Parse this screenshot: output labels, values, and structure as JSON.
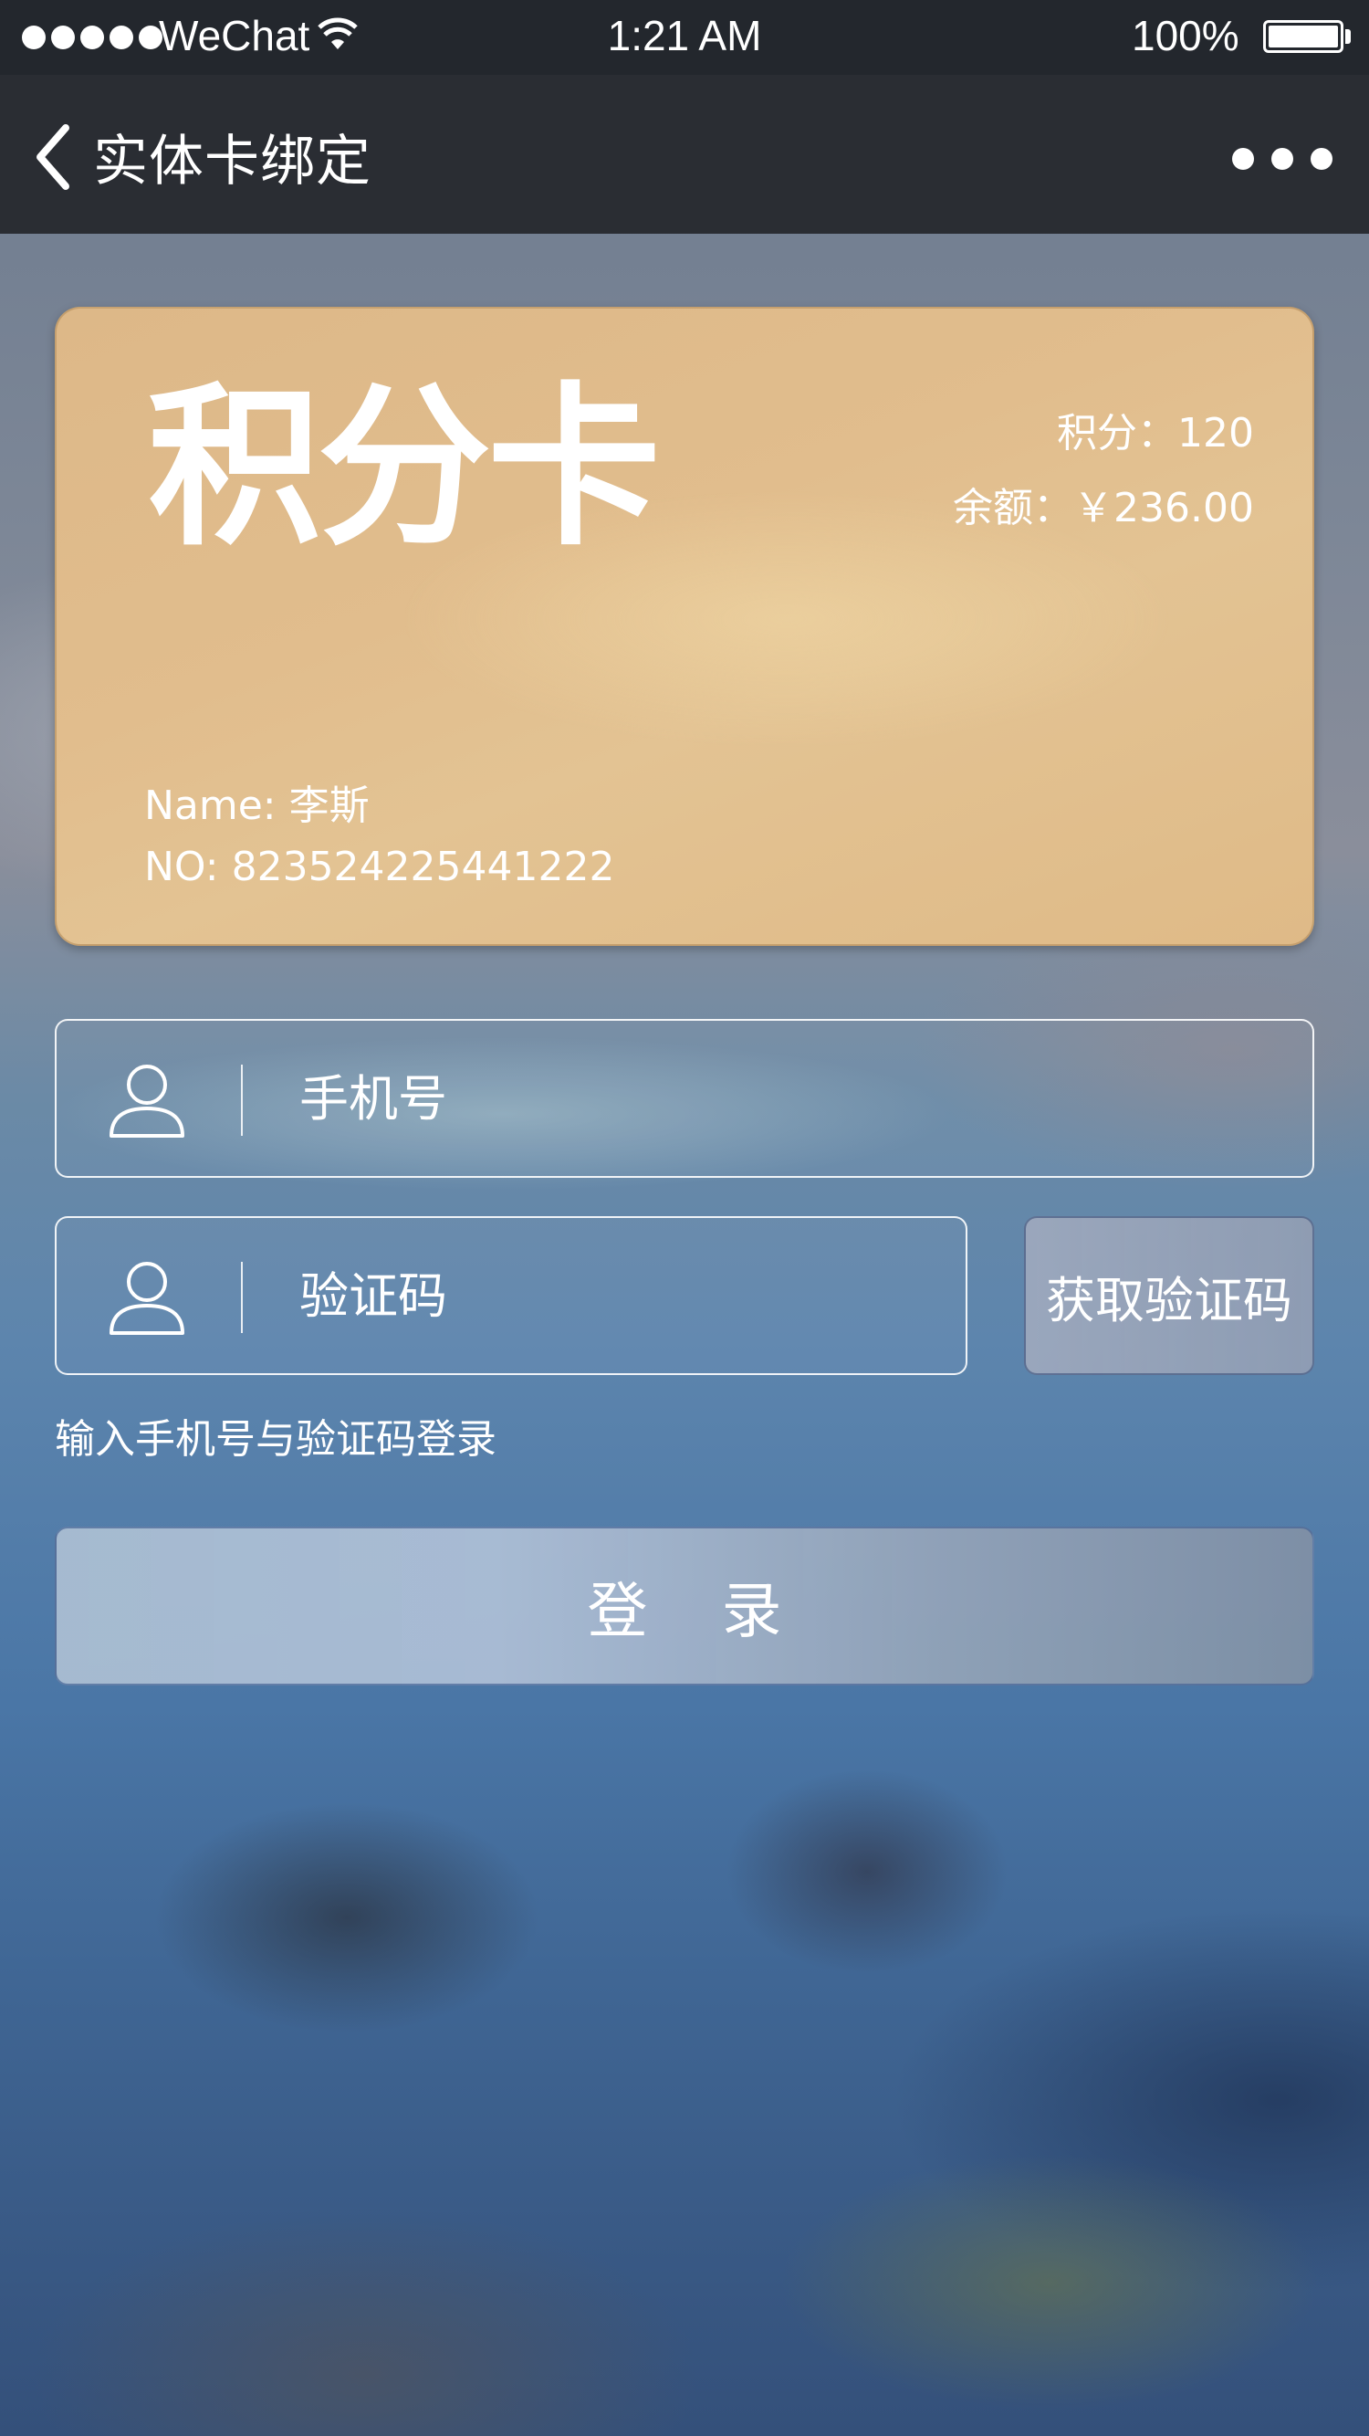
{
  "status_bar": {
    "carrier": "WeChat",
    "time": "1:21 AM",
    "battery_percent": "100%",
    "signal_dots": 5,
    "icons": [
      "signal-dots-icon",
      "wifi-icon",
      "battery-icon"
    ]
  },
  "nav": {
    "title": "实体卡绑定",
    "back_icon": "chevron-left-icon",
    "more_icon": "more-dots-icon"
  },
  "card": {
    "title": "积分卡",
    "points": "积分：120",
    "balance": "余额：￥236.00",
    "name": "Name: 李斯",
    "number": "NO: 823524225441222"
  },
  "form": {
    "phone_placeholder": "手机号",
    "code_placeholder": "验证码",
    "get_code_label": "获取验证码",
    "hint": "输入手机号与验证码登录",
    "login_label": "登 录",
    "field_icon": "user-icon"
  },
  "colors": {
    "status_bar_bg": "#23272d",
    "nav_bg": "#2a2d33",
    "card_gold": "#e1bd8d",
    "text": "#ffffff"
  }
}
